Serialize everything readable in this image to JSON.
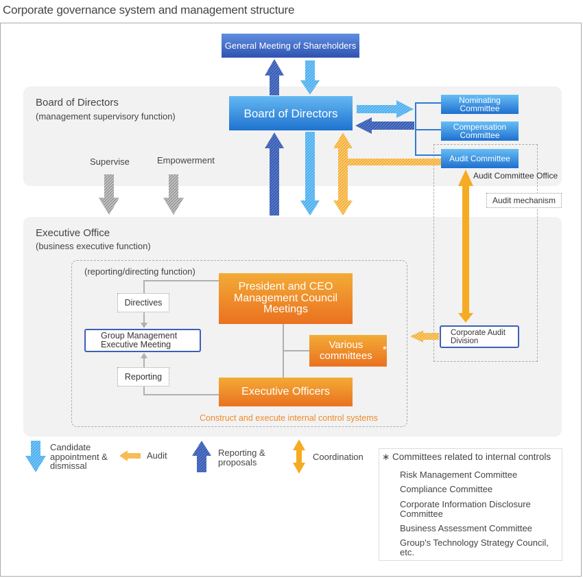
{
  "title": "Corporate governance system and management structure",
  "board_panel": {
    "title": "Board of Directors",
    "subtitle": "(management supervisory function)",
    "supervise_label": "Supervise",
    "empowerment_label": "Empowerment"
  },
  "general_meeting": "General Meeting of Shareholders",
  "board_box": "Board of Directors",
  "committees": [
    {
      "label": "Nominating Committee"
    },
    {
      "label": "Compensation Committee"
    },
    {
      "label": "Audit Committee"
    }
  ],
  "audit_committee_office": "Audit Committee Office",
  "audit_mechanism": "Audit mechanism",
  "exec_panel": {
    "title": "Executive Office",
    "subtitle": "(business executive function)",
    "reporting_directing": "(reporting/directing function)",
    "directives": "Directives",
    "reporting": "Reporting",
    "group_meeting": "Group Management Executive Meeting",
    "ceo_box": "President and CEO Management Council Meetings",
    "various_committees": "Various committees",
    "various_marker": "*",
    "executive_officers": "Executive Officers",
    "construct": "Construct and execute internal control systems",
    "corporate_audit": "Corporate Audit Division"
  },
  "legend": [
    {
      "icon": "light-blue-down-arrow",
      "label": "Candidate appointment & dismissal"
    },
    {
      "icon": "hatched-orange-left-arrow",
      "label": "Audit"
    },
    {
      "icon": "dark-blue-up-arrow",
      "label": "Reporting & proposals"
    },
    {
      "icon": "orange-double-arrow",
      "label": "Coordination"
    }
  ],
  "footnote": {
    "title": "∗ Committees related to internal controls",
    "items": [
      "Risk Management Committee",
      "Compliance Committee",
      "Corporate Information Disclosure Committee",
      "Business Assessment Committee",
      "Group's Technology Strategy Council, etc."
    ]
  },
  "colors": {
    "dark_blue": "#3a5fb8",
    "light_blue": "#4aaef0",
    "orange": "#f5a623",
    "gray": "#999999",
    "orange_text": "#f08a2b"
  }
}
